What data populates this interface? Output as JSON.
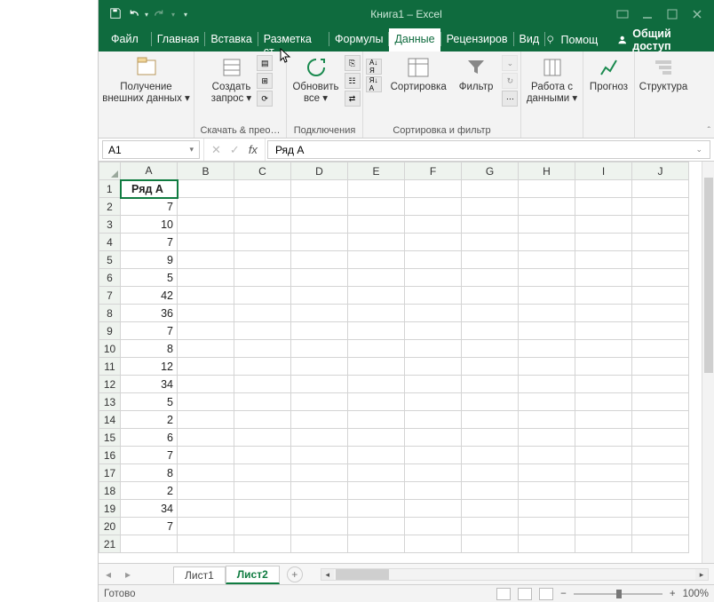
{
  "title": "Книга1 – Excel",
  "qat": {
    "save": "save-icon",
    "undo": "undo-icon",
    "redo": "redo-icon"
  },
  "tabs": {
    "file": "Файл",
    "home": "Главная",
    "insert": "Вставка",
    "layout": "Разметка ст",
    "formulas": "Формулы",
    "data": "Данные",
    "review": "Рецензиров",
    "view": "Вид",
    "help": "Помощ",
    "share": "Общий доступ"
  },
  "ribbon": {
    "ext": {
      "btn": "Получение\nвнешних данных ▾",
      "label": ""
    },
    "query": {
      "btn": "Создать\nзапрос ▾",
      "label": "Скачать & прео…"
    },
    "refresh": {
      "btn": "Обновить\nвсе ▾",
      "label": "Подключения"
    },
    "sort": {
      "btnA": "А↓\nЯ",
      "btnSort": "Сортировка"
    },
    "filter": {
      "btn": "Фильтр",
      "label": "Сортировка и фильтр"
    },
    "datawork": {
      "btn": "Работа с\nданными ▾"
    },
    "forecast": {
      "btn": "Прогноз"
    },
    "outline": {
      "btn": "Структура"
    }
  },
  "namebox": "A1",
  "formula": "Ряд А",
  "columns": [
    "A",
    "B",
    "C",
    "D",
    "E",
    "F",
    "G",
    "H",
    "I",
    "J"
  ],
  "rows": [
    {
      "n": 1,
      "a": "Ряд А",
      "bold": true,
      "sel": true
    },
    {
      "n": 2,
      "a": "7"
    },
    {
      "n": 3,
      "a": "10"
    },
    {
      "n": 4,
      "a": "7"
    },
    {
      "n": 5,
      "a": "9"
    },
    {
      "n": 6,
      "a": "5"
    },
    {
      "n": 7,
      "a": "42"
    },
    {
      "n": 8,
      "a": "36"
    },
    {
      "n": 9,
      "a": "7"
    },
    {
      "n": 10,
      "a": "8"
    },
    {
      "n": 11,
      "a": "12"
    },
    {
      "n": 12,
      "a": "34"
    },
    {
      "n": 13,
      "a": "5"
    },
    {
      "n": 14,
      "a": "2"
    },
    {
      "n": 15,
      "a": "6"
    },
    {
      "n": 16,
      "a": "7"
    },
    {
      "n": 17,
      "a": "8"
    },
    {
      "n": 18,
      "a": "2"
    },
    {
      "n": 19,
      "a": "34"
    },
    {
      "n": 20,
      "a": "7"
    },
    {
      "n": 21,
      "a": ""
    }
  ],
  "sheets": {
    "s1": "Лист1",
    "s2": "Лист2"
  },
  "status": {
    "ready": "Готово",
    "zoom": "100%"
  }
}
